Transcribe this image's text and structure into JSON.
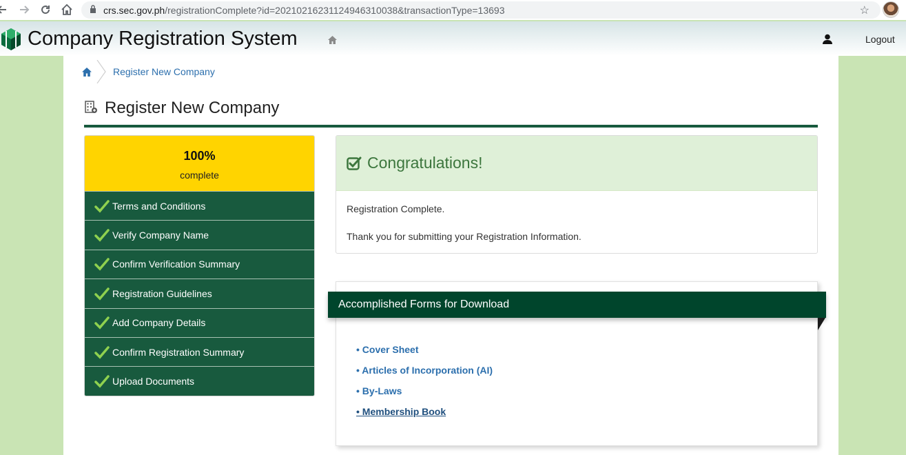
{
  "browser": {
    "url_host": "crs.sec.gov.ph",
    "url_path": "/registrationComplete?id=20210216231124946310038&transactionType=13693"
  },
  "header": {
    "app_title": "Company Registration System",
    "logout_label": "Logout"
  },
  "breadcrumb": {
    "current": "Register New Company"
  },
  "page": {
    "title": "Register New Company"
  },
  "progress": {
    "percent": "100%",
    "label": "complete"
  },
  "steps": [
    {
      "label": "Terms and Conditions"
    },
    {
      "label": "Verify Company Name"
    },
    {
      "label": "Confirm Verification Summary"
    },
    {
      "label": "Registration Guidelines"
    },
    {
      "label": "Add Company Details"
    },
    {
      "label": "Confirm Registration Summary"
    },
    {
      "label": "Upload Documents"
    }
  ],
  "congrats": {
    "title": "Congratulations!",
    "line1": "Registration Complete.",
    "line2": "Thank you for submitting your Registration Information."
  },
  "forms": {
    "heading": "Accomplished Forms for Download",
    "links": [
      {
        "label": "• Cover Sheet"
      },
      {
        "label": "• Articles of Incorporation (AI)"
      },
      {
        "label": "• By-Laws"
      },
      {
        "label": "• Membership Book"
      }
    ]
  },
  "colors": {
    "sidebar_green": "#185a3e",
    "progress_yellow": "#ffd400",
    "ribbon_green": "#00452c",
    "page_bg": "#c9e4b4",
    "link_blue": "#2c6fad"
  }
}
